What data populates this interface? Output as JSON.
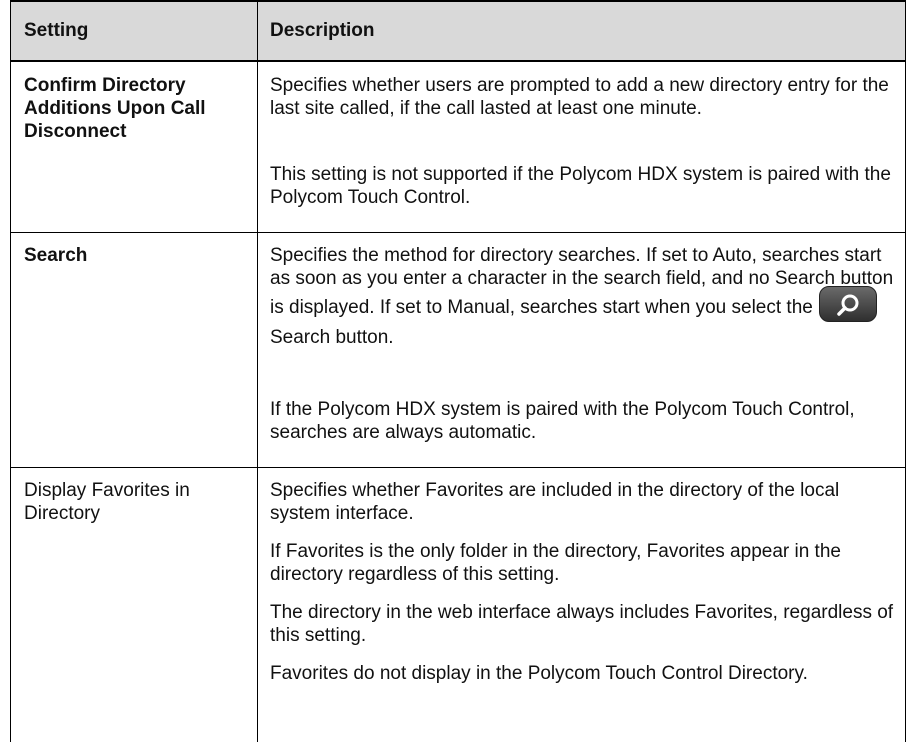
{
  "table": {
    "headers": {
      "setting": "Setting",
      "description": "Description"
    },
    "rows": [
      {
        "setting": "Confirm Directory Additions Upon Call Disconnect",
        "desc1": "Specifies whether users are prompted to add a new directory entry for the last site called, if the call lasted at least one minute.",
        "desc2": "This setting is not supported if the Polycom HDX system is paired with the Polycom Touch Control."
      },
      {
        "setting": "Search",
        "desc1_before": "Specifies the method for directory searches. If set to Auto, searches start as soon as you enter a character in the search field, and no Search button is displayed. If set to Manual, searches start when you select the",
        "desc1_after": "Search button.",
        "desc2": "If the Polycom HDX system is paired with the Polycom Touch Control, searches are always automatic."
      },
      {
        "setting": "Display Favorites in Directory",
        "desc1": "Specifies whether Favorites are included in the directory of the local system interface.",
        "desc2": "If Favorites is the only folder in the directory, Favorites appear in the directory regardless of this setting.",
        "desc3": "The directory in the web interface always includes Favorites, regardless of this setting.",
        "desc4": "Favorites do not display in the Polycom Touch Control Directory."
      }
    ]
  },
  "icons": {
    "search_button": "search-icon"
  }
}
